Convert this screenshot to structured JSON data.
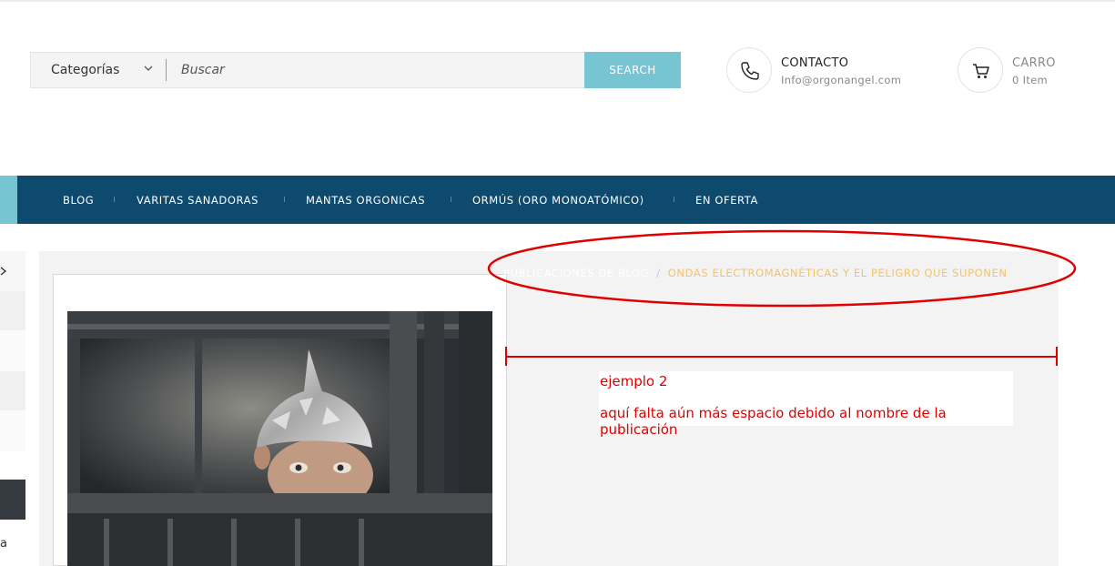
{
  "search": {
    "category_label": "Categorías",
    "placeholder": "Buscar",
    "button_label": "SEARCH"
  },
  "contact": {
    "title": "CONTACTO",
    "email": "Info@orgonangel.com"
  },
  "cart": {
    "title": "CARRO",
    "count": "0 Item"
  },
  "nav": {
    "items": [
      {
        "label": "BLOG"
      },
      {
        "label": "VARITAS SANADORAS"
      },
      {
        "label": "MANTAS ORGONICAS"
      },
      {
        "label": "ORMÚS (ORO MONOATÓMICO)"
      },
      {
        "label": "EN OFERTA"
      }
    ]
  },
  "sidebar": {
    "partial_text": "a"
  },
  "breadcrumb": {
    "home": "PUBLICACIONES DE BLOG",
    "separator": "/",
    "current": "ONDAS ELECTROMAGNÉTICAS Y EL PELIGRO QUE SUPONEN"
  },
  "annotation": {
    "line1": "ejemplo 2",
    "line2": "aquí falta aún más espacio debido al nombre de la publicación",
    "color": "#e10000"
  },
  "colors": {
    "nav_bg": "#0e4a6e",
    "accent": "#77c4d3",
    "breadcrumb_current": "#f3c26a"
  }
}
